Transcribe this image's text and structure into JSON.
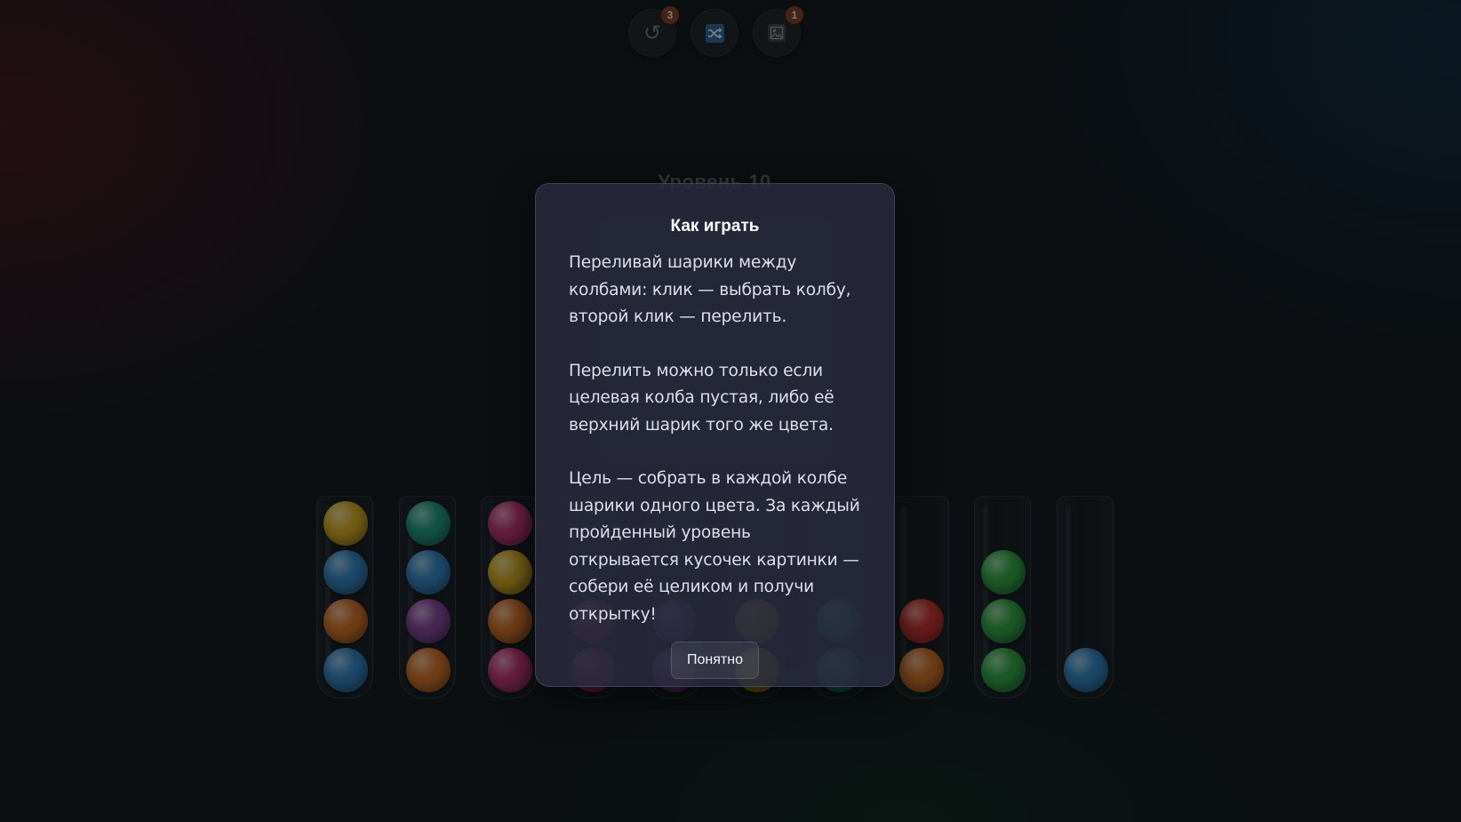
{
  "toolbar": {
    "undo": {
      "icon": "undo-icon",
      "glyph": "↺",
      "badge": "3"
    },
    "shuffle": {
      "icon": "shuffle-icon",
      "badge": ""
    },
    "picture": {
      "icon": "picture-icon",
      "badge": "1"
    }
  },
  "level": {
    "title": "Уровень 10"
  },
  "colors": {
    "yellow": "#c9a01e",
    "blue": "#2f7bb3",
    "orange": "#c66a22",
    "teal": "#1e8f72",
    "purple": "#7f3f90",
    "magenta": "#b5336a",
    "red": "#bc3028",
    "green": "#2d9a3f",
    "overlay": "#06080c",
    "modal_bg": "#282a3e"
  },
  "tubes": [
    [
      "blue",
      "orange",
      "blue",
      "yellow"
    ],
    [
      "orange",
      "purple",
      "blue",
      "teal"
    ],
    [
      "magenta",
      "orange",
      "yellow",
      "magenta"
    ],
    [
      "magenta",
      "magenta"
    ],
    [
      "purple",
      "purple"
    ],
    [
      "yellow",
      "yellow"
    ],
    [
      "teal",
      "teal"
    ],
    [
      "orange",
      "red"
    ],
    [
      "green",
      "green",
      "green"
    ],
    [
      "blue"
    ]
  ],
  "modal": {
    "title": "Как играть",
    "paragraphs": [
      "Переливай шарики между колбами: клик — выбрать колбу, второй клик — перелить.",
      "Перелить можно только если целевая колба пустая, либо её верхний шарик того же цвета.",
      "Цель — собрать в каждой колбе шарики одного цвета. За каждый пройденный уровень открывается кусочек картинки — собери её целиком и получи открытку!"
    ],
    "ok_label": "Понятно"
  }
}
